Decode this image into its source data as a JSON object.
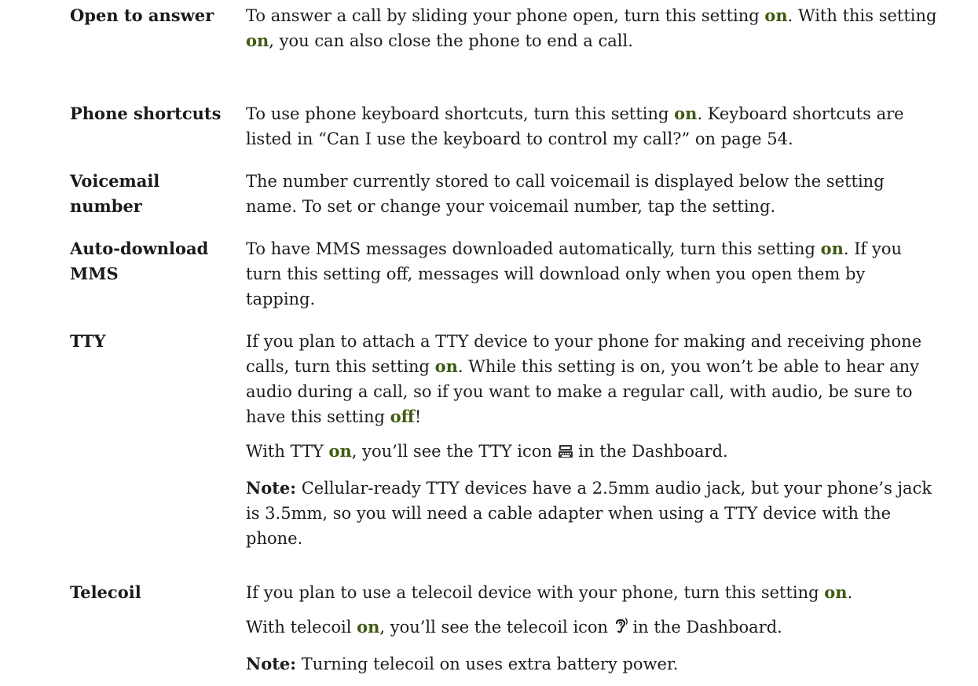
{
  "colors": {
    "text": "#1c1c1c",
    "highlight": "#3f5b12"
  },
  "settings": [
    {
      "term": "Open to answer",
      "paragraphs": [
        [
          {
            "t": "To answer a call by sliding your phone open, turn this setting "
          },
          {
            "t": "on",
            "hl": true
          },
          {
            "t": ". With this setting "
          },
          {
            "t": "on",
            "hl": true
          },
          {
            "t": ", you can also close the phone to end a call."
          }
        ]
      ]
    },
    {
      "term": "Phone shortcuts",
      "paragraphs": [
        [
          {
            "t": "To use phone keyboard shortcuts, turn this setting "
          },
          {
            "t": "on",
            "hl": true
          },
          {
            "t": ". Keyboard shortcuts are listed in “Can I use the keyboard to control my call?” on page 54."
          }
        ]
      ]
    },
    {
      "term": "Voicemail number",
      "paragraphs": [
        [
          {
            "t": "The number currently stored to call voicemail is displayed below the setting name. To set or change your voicemail number, tap the setting."
          }
        ]
      ]
    },
    {
      "term": "Auto-download MMS",
      "paragraphs": [
        [
          {
            "t": "To have MMS messages downloaded automatically, turn this setting "
          },
          {
            "t": "on",
            "hl": true
          },
          {
            "t": ". If you turn this setting off, messages will download only when you open them by tapping."
          }
        ]
      ]
    },
    {
      "term": "TTY",
      "paragraphs": [
        [
          {
            "t": "If you plan to attach a TTY device to your phone for making and receiving phone calls, turn this setting "
          },
          {
            "t": "on",
            "hl": true
          },
          {
            "t": ". While this setting is on, you won’t be able to hear any audio during a call, so if you want to make a regular call, with audio, be sure to have this setting "
          },
          {
            "t": "off",
            "hl": true
          },
          {
            "t": "!"
          }
        ],
        [
          {
            "t": "With TTY "
          },
          {
            "t": "on",
            "hl": true
          },
          {
            "t": ", you’ll see the TTY icon "
          },
          {
            "icon": "tty-icon"
          },
          {
            "t": " in the Dashboard."
          }
        ],
        [
          {
            "t": "Note:",
            "note": true
          },
          {
            "t": " Cellular-ready TTY devices have a 2.5mm audio jack, but your phone’s jack is 3.5mm, so you will need a cable adapter when using a TTY device with the phone."
          }
        ]
      ]
    },
    {
      "term": "Telecoil",
      "paragraphs": [
        [
          {
            "t": "If you plan to use a telecoil device with your phone, turn this setting "
          },
          {
            "t": "on",
            "hl": true
          },
          {
            "t": "."
          }
        ],
        [
          {
            "t": "With telecoil "
          },
          {
            "t": "on",
            "hl": true
          },
          {
            "t": ", you’ll see the telecoil icon "
          },
          {
            "icon": "ear-icon"
          },
          {
            "t": " in the Dashboard."
          }
        ],
        [
          {
            "t": "Note:",
            "note": true
          },
          {
            "t": " Turning telecoil on uses extra battery power."
          }
        ]
      ]
    }
  ]
}
